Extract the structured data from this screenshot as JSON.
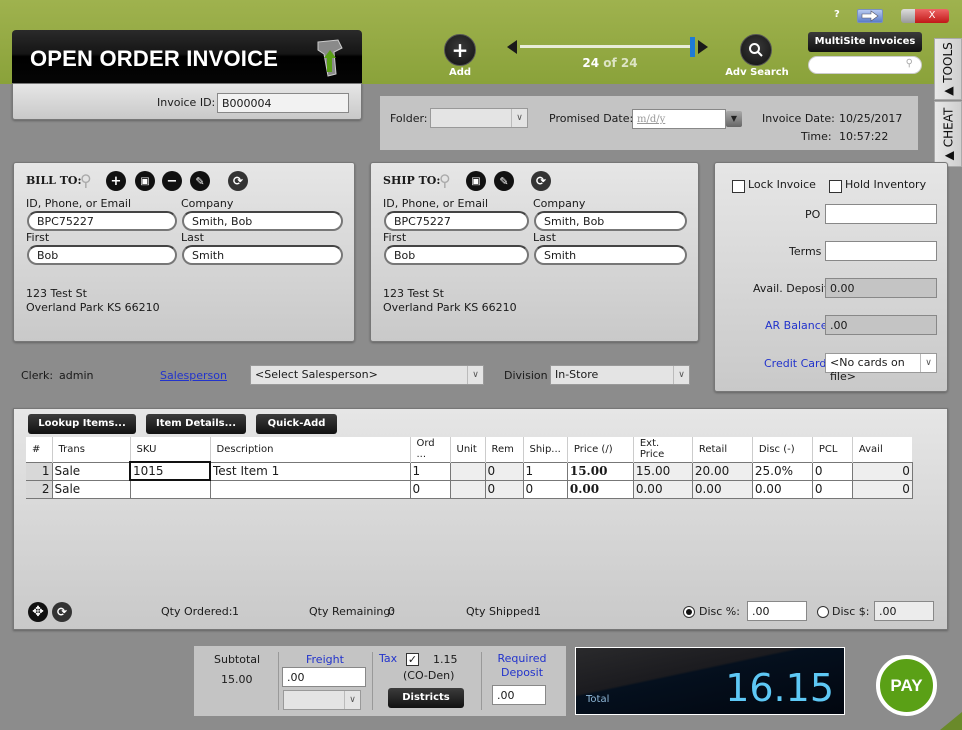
{
  "header": {
    "title": "OPEN ORDER INVOICE",
    "add_label": "Add",
    "adv_search_label": "Adv Search",
    "record_current": "24",
    "record_total_text": "of 24",
    "multisite_label": "MultiSite Invoices",
    "search_placeholder": "",
    "help_label": "?",
    "close_label": "X"
  },
  "side_tabs": {
    "tools": "▲ TOOLS",
    "cheat": "▲ CHEAT"
  },
  "invoice": {
    "id_label": "Invoice ID:",
    "id_value": "B000004",
    "folder_label": "Folder:",
    "folder_value": "",
    "promised_date_label": "Promised Date:",
    "promised_date_placeholder": "m/d/y",
    "invoice_date_label": "Invoice Date:",
    "invoice_date_value": "10/25/2017",
    "time_label": "Time:",
    "time_value": "10:57:22"
  },
  "bill_to": {
    "heading": "BILL TO:",
    "id_label": "ID, Phone, or Email",
    "id_value": "BPC75227",
    "company_label": "Company",
    "company_value": "Smith, Bob",
    "first_label": "First",
    "first_value": "Bob",
    "last_label": "Last",
    "last_value": "Smith",
    "address_line1": "123 Test St",
    "address_line2": "Overland Park KS 66210"
  },
  "ship_to": {
    "heading": "SHIP TO:",
    "id_label": "ID, Phone, or Email",
    "id_value": "BPC75227",
    "company_label": "Company",
    "company_value": "Smith, Bob",
    "first_label": "First",
    "first_value": "Bob",
    "last_label": "Last",
    "last_value": "Smith",
    "address_line1": "123 Test St",
    "address_line2": "Overland Park KS 66210"
  },
  "options": {
    "lock_invoice_label": "Lock Invoice",
    "lock_invoice_checked": false,
    "hold_inventory_label": "Hold Inventory",
    "hold_inventory_checked": false,
    "po_label": "PO",
    "po_value": "",
    "terms_label": "Terms",
    "terms_value": "",
    "avail_deposit_label": "Avail. Deposit",
    "avail_deposit_value": "0.00",
    "ar_balance_label": "AR Balance",
    "ar_balance_value": ".00",
    "credit_card_label": "Credit Card",
    "credit_card_value": "<No cards on file>"
  },
  "staff": {
    "clerk_label": "Clerk:",
    "clerk_value": "admin",
    "salesperson_label": "Salesperson",
    "salesperson_value": "<Select Salesperson>",
    "division_label": "Division",
    "division_value": "In-Store"
  },
  "items": {
    "buttons": {
      "lookup": "Lookup Items...",
      "details": "Item Details...",
      "quick_add": "Quick-Add"
    },
    "columns": [
      "#",
      "Trans",
      "SKU",
      "Description",
      "Ord ...",
      "Unit",
      "Rem",
      "Ship...",
      "Price (/)",
      "Ext. Price",
      "Retail",
      "Disc (-)",
      "PCL",
      "Avail"
    ],
    "rows": [
      {
        "num": "1",
        "trans": "Sale",
        "sku": "1015",
        "description": "Test Item 1",
        "ord": "1",
        "unit": "",
        "rem": "0",
        "ship": "1",
        "price": "15.00",
        "ext_price": "15.00",
        "retail": "20.00",
        "disc": "25.0%",
        "pcl": "0",
        "avail": "0"
      },
      {
        "num": "2",
        "trans": "Sale",
        "sku": "",
        "description": "",
        "ord": "0",
        "unit": "",
        "rem": "0",
        "ship": "0",
        "price": "0.00",
        "ext_price": "0.00",
        "retail": "0.00",
        "disc": "0.00",
        "pcl": "0",
        "avail": "0"
      }
    ],
    "qty_ordered_label": "Qty Ordered:",
    "qty_ordered_value": "1",
    "qty_remaining_label": "Qty Remaining:",
    "qty_remaining_value": "0",
    "qty_shipped_label": "Qty Shipped:",
    "qty_shipped_value": "1",
    "disc_pct_label": "Disc %:",
    "disc_pct_value": ".00",
    "disc_pct_selected": true,
    "disc_amt_label": "Disc $:",
    "disc_amt_value": ".00"
  },
  "totals": {
    "subtotal_label": "Subtotal",
    "subtotal_value": "15.00",
    "freight_label": "Freight",
    "freight_value": ".00",
    "tax_label": "Tax",
    "tax_checked": true,
    "tax_value": "1.15",
    "tax_district": "(CO-Den)",
    "districts_label": "Districts",
    "required_deposit_label": "Required Deposit",
    "required_deposit_value": ".00",
    "total_label": "Total",
    "total_value": "16.15",
    "pay_label": "PAY"
  },
  "colors": {
    "header_green": "#9fb24e",
    "pay_green": "#5aa016",
    "total_blue": "#5ec8f5",
    "link_blue": "#2233cc",
    "slider_blue": "#1e7bd6"
  }
}
